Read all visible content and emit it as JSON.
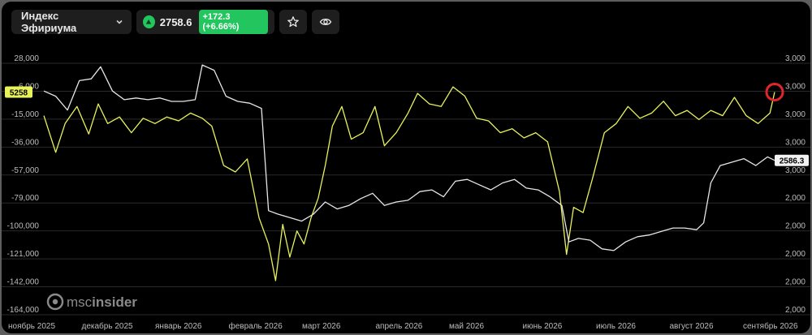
{
  "toolbar": {
    "title": "Индекс Эфириума",
    "price": "2758.6",
    "change": "+172.3 (+6.66%)",
    "icons": [
      "chevron-down-icon",
      "up-arrow-icon",
      "star-icon",
      "eye-icon"
    ]
  },
  "watermark": "msc",
  "watermark_bold": "insider",
  "colors": {
    "background": "#000000",
    "yellow_series": "#e8f25a",
    "white_series": "#e6e6e6",
    "positive": "#22c55e",
    "marker": "#e0262a"
  },
  "chart_data": {
    "type": "line",
    "title": "",
    "xlabel": "",
    "ylabel": "",
    "x_tick_labels": [
      "ноябрь 2025",
      "декабрь 2025",
      "январь 2026",
      "февраль 2026",
      "март 2026",
      "апрель 2026",
      "май 2026",
      "июнь 2026",
      "июль 2026",
      "август 2026",
      "сентябрь 2026"
    ],
    "x_range": [
      "2025-10-29",
      "2026-09-03"
    ],
    "left_axis": {
      "ticks": [
        "28,000",
        "6,000",
        "-15,000",
        "-36,000",
        "-57,000",
        "-79,000",
        "-100,000",
        "-121,000",
        "-142,000",
        "-164,000"
      ],
      "ylim": [
        -164000,
        28000
      ]
    },
    "right_axis": {
      "ticks": [
        "3,000",
        "3,000",
        "3,000",
        "3,000",
        "3,000",
        "2,000",
        "2,000",
        "2,000",
        "2,000",
        "2,000"
      ],
      "ylim": [
        1700,
        3150
      ]
    },
    "left_axis_label": "5258",
    "right_axis_label": "2586.3",
    "grid": true,
    "series": [
      {
        "axis": "left",
        "color": "#e8f25a",
        "x": [
          "2025-10-29",
          "2025-11-03",
          "2025-11-07",
          "2025-11-12",
          "2025-11-17",
          "2025-11-21",
          "2025-11-25",
          "2025-11-30",
          "2025-12-05",
          "2025-12-10",
          "2025-12-15",
          "2025-12-20",
          "2025-12-25",
          "2025-12-30",
          "2026-01-04",
          "2026-01-08",
          "2026-01-13",
          "2026-01-18",
          "2026-01-23",
          "2026-01-28",
          "2026-02-01",
          "2026-02-04",
          "2026-02-07",
          "2026-02-10",
          "2026-02-13",
          "2026-02-16",
          "2026-02-19",
          "2026-02-22",
          "2026-02-25",
          "2026-02-28",
          "2026-03-04",
          "2026-03-08",
          "2026-03-13",
          "2026-03-18",
          "2026-03-22",
          "2026-03-27",
          "2026-04-01",
          "2026-04-05",
          "2026-04-10",
          "2026-04-15",
          "2026-04-20",
          "2026-04-25",
          "2026-04-30",
          "2026-05-05",
          "2026-05-10",
          "2026-05-15",
          "2026-05-20",
          "2026-05-25",
          "2026-05-30",
          "2026-06-04",
          "2026-06-07",
          "2026-06-10",
          "2026-06-14",
          "2026-06-18",
          "2026-06-23",
          "2026-06-28",
          "2026-07-03",
          "2026-07-08",
          "2026-07-13",
          "2026-07-18",
          "2026-07-23",
          "2026-07-28",
          "2026-08-02",
          "2026-08-07",
          "2026-08-12",
          "2026-08-17",
          "2026-08-22",
          "2026-08-27",
          "2026-09-01",
          "2026-09-03"
        ],
        "values": [
          -12000,
          -40000,
          -18000,
          -5000,
          -26000,
          -3000,
          -18000,
          -13000,
          -25000,
          -14000,
          -18000,
          -13000,
          -16000,
          -10000,
          -14000,
          -20000,
          -50000,
          -55000,
          -45000,
          -90000,
          -110000,
          -138000,
          -95000,
          -120000,
          -100000,
          -110000,
          -90000,
          -75000,
          -50000,
          -20000,
          -5000,
          -30000,
          -25000,
          -5000,
          -35000,
          -25000,
          -10000,
          5000,
          -3000,
          -5000,
          10000,
          3000,
          -14000,
          -16000,
          -25000,
          -22000,
          -29000,
          -25000,
          -32000,
          -70000,
          -118000,
          -82000,
          -86000,
          -60000,
          -25000,
          -18000,
          -5000,
          -14000,
          -10000,
          -1000,
          -12000,
          -8000,
          -15000,
          -8000,
          -12000,
          2000,
          -12000,
          -18000,
          -10000,
          6000
        ]
      },
      {
        "axis": "right",
        "color": "#e6e6e6",
        "x": [
          "2025-10-29",
          "2025-11-03",
          "2025-11-08",
          "2025-11-13",
          "2025-11-18",
          "2025-11-22",
          "2025-11-27",
          "2025-12-02",
          "2025-12-07",
          "2025-12-12",
          "2025-12-17",
          "2025-12-22",
          "2025-12-27",
          "2026-01-01",
          "2026-01-04",
          "2026-01-09",
          "2026-01-14",
          "2026-01-19",
          "2026-01-24",
          "2026-01-29",
          "2026-02-01",
          "2026-02-05",
          "2026-02-10",
          "2026-02-15",
          "2026-02-20",
          "2026-02-25",
          "2026-03-02",
          "2026-03-07",
          "2026-03-12",
          "2026-03-17",
          "2026-03-22",
          "2026-03-27",
          "2026-04-01",
          "2026-04-06",
          "2026-04-11",
          "2026-04-16",
          "2026-04-21",
          "2026-04-26",
          "2026-05-01",
          "2026-05-06",
          "2026-05-11",
          "2026-05-16",
          "2026-05-21",
          "2026-05-26",
          "2026-05-31",
          "2026-06-05",
          "2026-06-08",
          "2026-06-12",
          "2026-06-17",
          "2026-06-22",
          "2026-06-27",
          "2026-07-02",
          "2026-07-07",
          "2026-07-12",
          "2026-07-17",
          "2026-07-22",
          "2026-07-27",
          "2026-08-01",
          "2026-08-04",
          "2026-08-07",
          "2026-08-11",
          "2026-08-16",
          "2026-08-21",
          "2026-08-26",
          "2026-08-31",
          "2026-09-03"
        ],
        "values": [
          2990,
          2960,
          2880,
          3050,
          3060,
          3130,
          2990,
          2940,
          2950,
          2940,
          2950,
          2930,
          2930,
          2940,
          3140,
          3110,
          2960,
          2930,
          2920,
          2890,
          2300,
          2280,
          2260,
          2240,
          2280,
          2350,
          2310,
          2330,
          2370,
          2400,
          2330,
          2350,
          2360,
          2410,
          2420,
          2380,
          2470,
          2480,
          2450,
          2420,
          2460,
          2480,
          2430,
          2420,
          2380,
          2330,
          2120,
          2140,
          2130,
          2080,
          2070,
          2120,
          2150,
          2160,
          2180,
          2200,
          2200,
          2190,
          2230,
          2460,
          2560,
          2580,
          2600,
          2560,
          2610,
          2590
        ]
      }
    ]
  }
}
